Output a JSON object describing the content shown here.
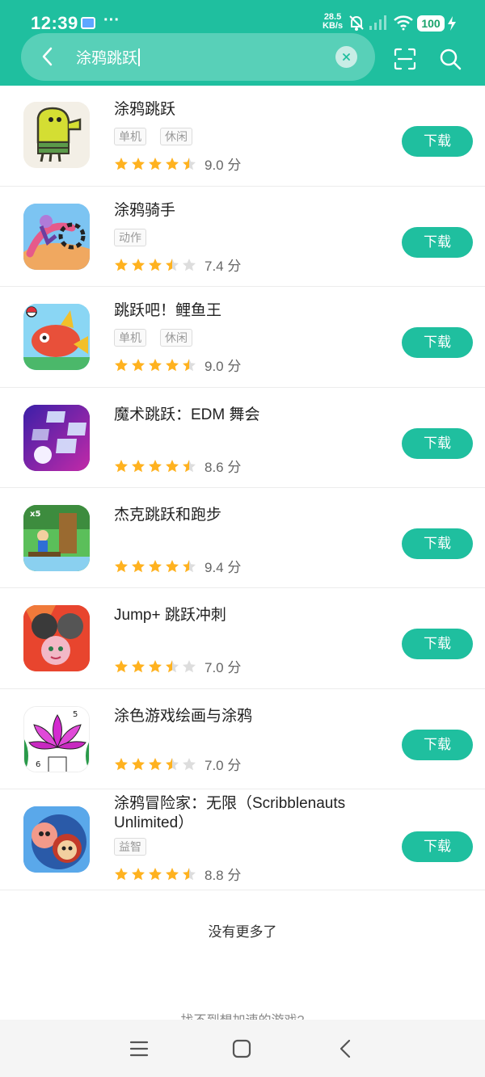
{
  "status_bar": {
    "time": "12:39",
    "more_indicator": "···",
    "speed_value": "28.5",
    "speed_unit": "KB/s",
    "battery": "100",
    "icons": [
      "mail-icon",
      "mute-icon",
      "signal-icon",
      "wifi-icon",
      "battery-icon",
      "charging-icon"
    ]
  },
  "search": {
    "query": "涂鸦跳跃",
    "icons": [
      "back-icon",
      "clear-icon",
      "scan-icon",
      "search-icon"
    ]
  },
  "results": [
    {
      "name": "涂鸦跳跃",
      "tags": [
        "单机",
        "休闲"
      ],
      "rating": 4.5,
      "score": "9.0 分",
      "button": "下载"
    },
    {
      "name": "涂鸦骑手",
      "tags": [
        "动作"
      ],
      "rating": 3.5,
      "score": "7.4 分",
      "button": "下载"
    },
    {
      "name": "跳跃吧！鲤鱼王",
      "tags": [
        "单机",
        "休闲"
      ],
      "rating": 4.5,
      "score": "9.0 分",
      "button": "下载"
    },
    {
      "name": "魔术跳跃：EDM 舞会",
      "tags": [],
      "rating": 4.5,
      "score": "8.6 分",
      "button": "下载"
    },
    {
      "name": "杰克跳跃和跑步",
      "tags": [],
      "rating": 4.5,
      "score": "9.4 分",
      "button": "下载"
    },
    {
      "name": "Jump+ 跳跃冲刺",
      "tags": [],
      "rating": 3.5,
      "score": "7.0 分",
      "button": "下载"
    },
    {
      "name": "涂色游戏绘画与涂鸦",
      "tags": [],
      "rating": 3.5,
      "score": "7.0 分",
      "button": "下载"
    },
    {
      "name": "涂鸦冒险家：无限（Scribblenauts Unlimited）",
      "tags": [
        "益智"
      ],
      "rating": 4.5,
      "score": "8.8 分",
      "button": "下载"
    }
  ],
  "footer": {
    "end_text": "没有更多了",
    "hint_text": "找不到想加速的游戏?"
  },
  "nav": {
    "icons": [
      "menu-icon",
      "home-icon",
      "back-icon"
    ]
  },
  "colors": {
    "accent": "#1fbf9f",
    "star": "#ffb21f",
    "star_empty": "#dddddd"
  }
}
